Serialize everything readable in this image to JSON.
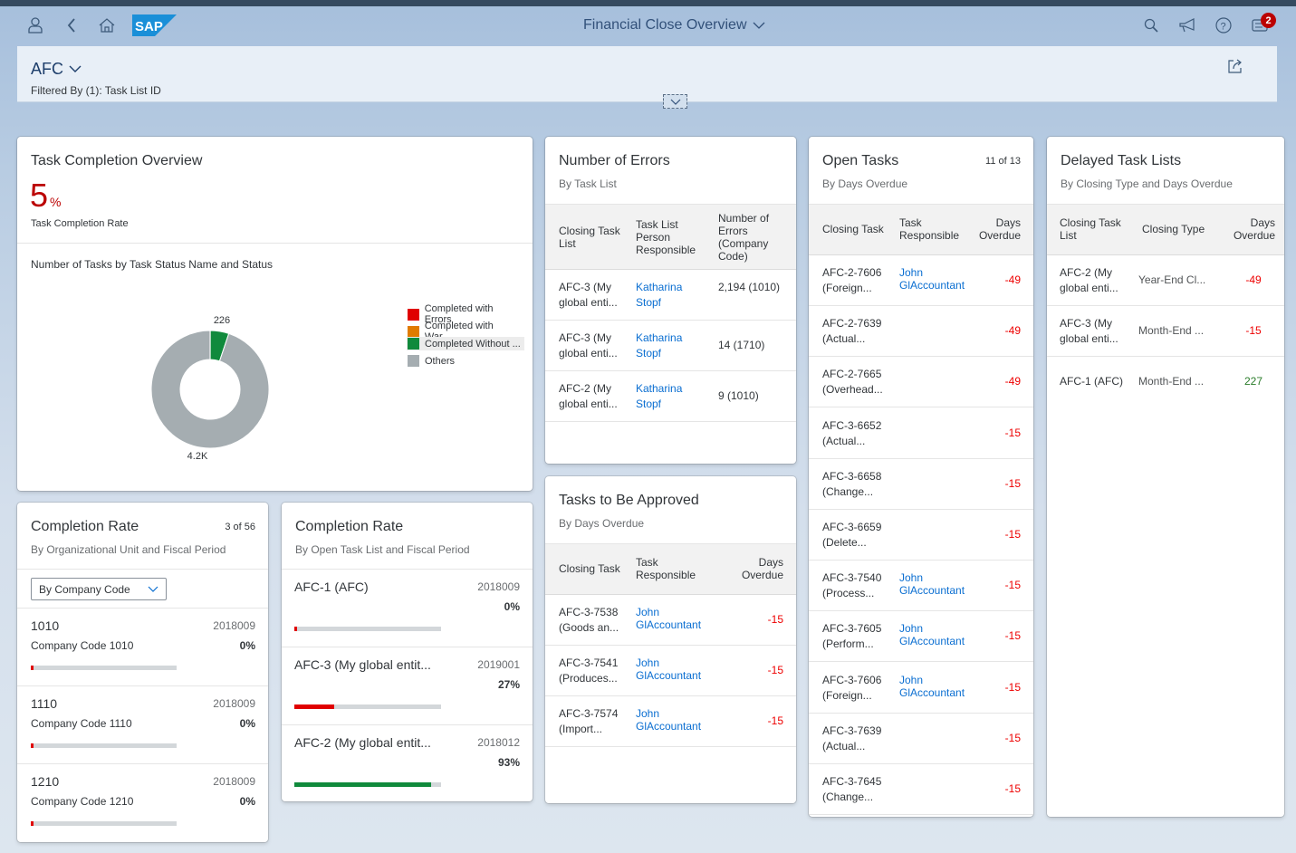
{
  "shell": {
    "app_title": "Financial Close Overview",
    "notification_count": "2",
    "logo_text": "SAP",
    "icons": [
      "user-icon",
      "back-icon",
      "home-icon",
      "search-icon",
      "megaphone-icon",
      "help-icon",
      "notifications-icon"
    ]
  },
  "header": {
    "variant": "AFC",
    "filtered_by": "Filtered By (1): Task List ID"
  },
  "task_overview": {
    "title": "Task Completion Overview",
    "kpi_value": "5",
    "kpi_unit": "%",
    "kpi_label": "Task Completion Rate",
    "chart_title": "Number of Tasks by Task Status Name and Status"
  },
  "chart_data": {
    "type": "pie",
    "variant": "donut",
    "title": "Number of Tasks by Task Status Name and Status",
    "categories": [
      "Completed with Errors",
      "Completed with War...",
      "Completed Without ...",
      "Others"
    ],
    "values": [
      2,
      0,
      226,
      4200
    ],
    "data_labels": [
      "",
      "",
      "226",
      "4.2K"
    ],
    "colors": [
      "#e00000",
      "#e17b00",
      "#108a3c",
      "#a5adb1"
    ],
    "legend_position": "right",
    "selected_legend_item": "Completed Without ..."
  },
  "errors_card": {
    "title": "Number of Errors",
    "subtitle": "By Task List",
    "columns": [
      "Closing Task List",
      "Task List Person Responsible",
      "Number of Errors (Company Code)"
    ],
    "rows": [
      {
        "list": "AFC-3 (My global enti...",
        "person": "Katharina Stopf",
        "errors": "2,194 (1010)"
      },
      {
        "list": "AFC-3 (My global enti...",
        "person": "Katharina Stopf",
        "errors": "14 (1710)"
      },
      {
        "list": "AFC-2 (My global enti...",
        "person": "Katharina Stopf",
        "errors": "9 (1010)"
      }
    ]
  },
  "approve_card": {
    "title": "Tasks to Be Approved",
    "subtitle": "By Days Overdue",
    "columns": [
      "Closing Task",
      "Task Responsible",
      "Days Overdue"
    ],
    "rows": [
      {
        "task": "AFC-3-7538",
        "desc": "(Goods an...",
        "resp1": "John",
        "resp2": "GlAccountant",
        "days": "-15"
      },
      {
        "task": "AFC-3-7541",
        "desc": "(Produces...",
        "resp1": "John",
        "resp2": "GlAccountant",
        "days": "-15"
      },
      {
        "task": "AFC-3-7574",
        "desc": "(Import...",
        "resp1": "John",
        "resp2": "GlAccountant",
        "days": "-15"
      }
    ]
  },
  "open_tasks": {
    "title": "Open Tasks",
    "subtitle": "By Days Overdue",
    "count": "11 of 13",
    "columns": [
      "Closing Task",
      "Task Responsible",
      "Days Overdue"
    ],
    "rows": [
      {
        "task": "AFC-2-7606",
        "desc": "(Foreign...",
        "resp1": "John",
        "resp2": "GlAccountant",
        "days": "-49"
      },
      {
        "task": "AFC-2-7639",
        "desc": "(Actual...",
        "resp1": "",
        "resp2": "",
        "days": "-49"
      },
      {
        "task": "AFC-2-7665",
        "desc": "(Overhead...",
        "resp1": "",
        "resp2": "",
        "days": "-49"
      },
      {
        "task": "AFC-3-6652",
        "desc": "(Actual...",
        "resp1": "",
        "resp2": "",
        "days": "-15"
      },
      {
        "task": "AFC-3-6658",
        "desc": "(Change...",
        "resp1": "",
        "resp2": "",
        "days": "-15"
      },
      {
        "task": "AFC-3-6659",
        "desc": "(Delete...",
        "resp1": "",
        "resp2": "",
        "days": "-15"
      },
      {
        "task": "AFC-3-7540",
        "desc": "(Process...",
        "resp1": "John",
        "resp2": "GlAccountant",
        "days": "-15"
      },
      {
        "task": "AFC-3-7605",
        "desc": "(Perform...",
        "resp1": "John",
        "resp2": "GlAccountant",
        "days": "-15"
      },
      {
        "task": "AFC-3-7606",
        "desc": "(Foreign...",
        "resp1": "John",
        "resp2": "GlAccountant",
        "days": "-15"
      },
      {
        "task": "AFC-3-7639",
        "desc": "(Actual...",
        "resp1": "",
        "resp2": "",
        "days": "-15"
      },
      {
        "task": "AFC-3-7645",
        "desc": "(Change...",
        "resp1": "",
        "resp2": "",
        "days": "-15"
      }
    ]
  },
  "delayed": {
    "title": "Delayed Task Lists",
    "subtitle": "By Closing Type and Days Overdue",
    "columns": [
      "Closing Task List",
      "Closing Type",
      "Days Overdue"
    ],
    "rows": [
      {
        "l1": "AFC-2 (My",
        "l2": "global enti...",
        "type": "Year-End Cl...",
        "days": "-49",
        "status": "neg"
      },
      {
        "l1": "AFC-3 (My",
        "l2": "global enti...",
        "type": "Month-End ...",
        "days": "-15",
        "status": "neg"
      },
      {
        "l1": "AFC-1 (AFC)",
        "l2": "",
        "type": "Month-End ...",
        "days": "227",
        "status": "pos"
      }
    ]
  },
  "rate_org": {
    "title": "Completion Rate",
    "subtitle": "By Organizational Unit and Fiscal Period",
    "count": "3 of 56",
    "select_value": "By Company Code",
    "items": [
      {
        "code": "1010",
        "name": "Company Code 1010",
        "period": "2018009",
        "pct": "0%",
        "value": 0.02,
        "color": "#e00000"
      },
      {
        "code": "1110",
        "name": "Company Code 1110",
        "period": "2018009",
        "pct": "0%",
        "value": 0.02,
        "color": "#e00000"
      },
      {
        "code": "1210",
        "name": "Company Code 1210",
        "period": "2018009",
        "pct": "0%",
        "value": 0.02,
        "color": "#e00000"
      }
    ]
  },
  "rate_list": {
    "title": "Completion Rate",
    "subtitle": "By Open Task List and Fiscal Period",
    "items": [
      {
        "name": "AFC-1 (AFC)",
        "period": "2018009",
        "pct": "0%",
        "value": 0.02,
        "color": "#e00000"
      },
      {
        "name": "AFC-3 (My global entit...",
        "period": "2019001",
        "pct": "27%",
        "value": 0.27,
        "color": "#e00000"
      },
      {
        "name": "AFC-2 (My global entit...",
        "period": "2018012",
        "pct": "93%",
        "value": 0.93,
        "color": "#108a3c"
      }
    ]
  }
}
